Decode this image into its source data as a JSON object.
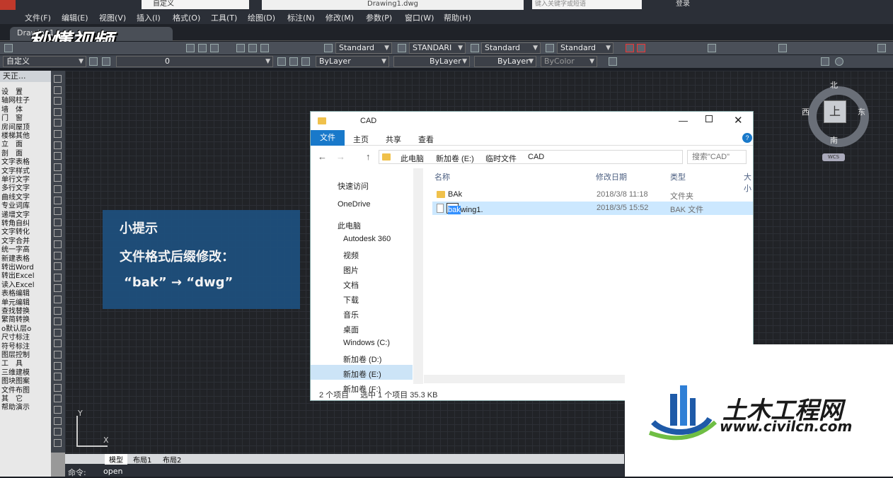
{
  "titlebar": {
    "workspace": "自定义",
    "document": "Drawing1.dwg",
    "search_placeholder": "键入关键字或短语",
    "login": "登录"
  },
  "menubar": [
    "文件(F)",
    "编辑(E)",
    "视图(V)",
    "插入(I)",
    "格式(O)",
    "工具(T)",
    "绘图(D)",
    "标注(N)",
    "修改(M)",
    "参数(P)",
    "窗口(W)",
    "帮助(H)"
  ],
  "tab": {
    "label": "Drawing1"
  },
  "watermark": "秒懂视频",
  "toolbar1": {
    "style1": "Standard",
    "style2": "STANDARI",
    "style3": "Standard",
    "style4": "Standard"
  },
  "toolbar2": {
    "workspace": "自定义",
    "layer": "0",
    "color": "ByLayer",
    "linetype": "ByLayer",
    "lineweight": "ByLayer",
    "plotstyle": "ByColor"
  },
  "leftpanel": {
    "header": "天正...",
    "items": [
      "设　置",
      "轴网柱子",
      "墙　体",
      "门　窗",
      "房间屋顶",
      "楼梯其他",
      "立　面",
      "剖　面",
      "文字表格",
      "文字样式",
      "单行文字",
      "多行文字",
      "曲线文字",
      "专业词库",
      "递增文字",
      "转角自纠",
      "文字转化",
      "文字合并",
      "统一字高",
      "新建表格",
      "转出Word",
      "转出Excel",
      "读入Excel",
      "表格编辑",
      "单元编辑",
      "查找替换",
      "繁简转换",
      "o默认层o",
      "尺寸标注",
      "符号标注",
      "图层控制",
      "工　具",
      "三维建模",
      "图块图案",
      "文件布图",
      "其　它",
      "帮助演示"
    ]
  },
  "tip": {
    "title": "小提示",
    "line1": "文件格式后缀修改：",
    "line2": "“bak” → “dwg”"
  },
  "explorer": {
    "title": "CAD",
    "ribbon_tabs": [
      "文件",
      "主页",
      "共享",
      "查看"
    ],
    "breadcrumb": [
      "此电脑",
      "新加卷 (E:)",
      "临时文件",
      "CAD"
    ],
    "search_placeholder": "搜索\"CAD\"",
    "nav": [
      "快速访问",
      "OneDrive",
      "此电脑",
      "Autodesk 360",
      "视频",
      "图片",
      "文档",
      "下载",
      "音乐",
      "桌面",
      "Windows (C:)",
      "新加卷 (D:)",
      "新加卷 (E:)",
      "新加卷 (F:)"
    ],
    "columns": [
      "名称",
      "修改日期",
      "类型",
      "大小"
    ],
    "rows": [
      {
        "name": "BAk",
        "date": "2018/3/8 11:18",
        "type": "文件夹"
      },
      {
        "name_prefix": "Drawing1.",
        "name_selected": "bak",
        "date": "2018/3/5 15:52",
        "type": "BAK 文件"
      }
    ],
    "status": {
      "count": "2 个项目",
      "selected": "选中 1 个项目  35.3 KB"
    }
  },
  "viewcube": {
    "north": "北",
    "south": "南",
    "east": "东",
    "west": "西",
    "top": "上",
    "wcs": "WCS"
  },
  "layout_tabs": [
    "模型",
    "布局1",
    "布局2"
  ],
  "command": {
    "prompt": "命令:",
    "value": "open"
  },
  "ucs": {
    "x": "X",
    "y": "Y"
  },
  "logo": {
    "name": "土木工程网",
    "url": "www.civilcn.com"
  },
  "colors": {
    "accent": "#1979ca",
    "tip_bg": "#1e4f7c",
    "logo_blue": "#1e5aa8"
  }
}
